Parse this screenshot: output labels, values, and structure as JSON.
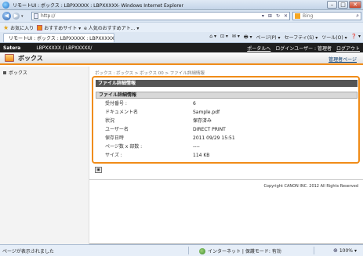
{
  "window": {
    "title": "リモートUI : ボックス : LBPXXXXX : LBPXXXXX- Windows Internet Explorer",
    "controls": {
      "minimize": "–",
      "maximize": "□",
      "close": "✕"
    }
  },
  "address_bar": {
    "url": "http://",
    "tools": [
      "▾",
      "⊞",
      "↻",
      "✕"
    ],
    "search_placeholder": "Bing"
  },
  "favorites_bar": {
    "favorites_label": "お気に入り",
    "items": [
      "おすすめサイト ▾",
      "e 人気のおすすめアト... ▾"
    ]
  },
  "tab": {
    "title": "リモートUI : ボックス : LBPXXXXX : LBPXXXXX"
  },
  "command_bar": {
    "items": [
      "⌂ ▾",
      "⊡ ▾",
      "✉ ▾",
      "🖶 ▾",
      "ページ(P) ▾",
      "セーフティ(S) ▾",
      "ツール(O) ▾",
      "❓ ▾"
    ]
  },
  "header": {
    "brand": "Satera",
    "device": "LBPXXXXX / LBPXXXXX/",
    "portal_link": "ポータルへ",
    "user_label": "ログインユーザー : 管理者",
    "logout_link": "ログアウト"
  },
  "mailbox_bar": {
    "title": "ボックス",
    "admin_link": "管理者ページ"
  },
  "sidebar": {
    "items": [
      {
        "label": "ボックス"
      }
    ]
  },
  "breadcrumb": "ボックス : ボックス > ボックス 00 > ファイル詳細情報",
  "panel": {
    "title": "ファイル詳細情報",
    "subtitle": "ファイル詳細情報",
    "rows": [
      {
        "label": "受付番号 :",
        "value": "6"
      },
      {
        "label": "ドキュメント名",
        "value": "Sample.pdf"
      },
      {
        "label": "状況",
        "value": "保存済み"
      },
      {
        "label": "ユーザー名",
        "value": "DIRECT PRINT"
      },
      {
        "label": "保存日時",
        "value": "2011 09/29 15:51"
      },
      {
        "label": "ページ数 x 部数 :",
        "value": "----"
      },
      {
        "label": "サイズ :",
        "value": "114 KB"
      }
    ]
  },
  "back_button": "▣",
  "copyright": "Copyright CANON INC. 2012 All Rights Reserved",
  "status_bar": {
    "text": "ページが表示されました",
    "zone": "インターネット | 保護モード: 有効",
    "zoom": "100%"
  },
  "colors": {
    "accent": "#f08c18",
    "header_dark": "#1e1e1e",
    "panel_header": "#555555"
  }
}
